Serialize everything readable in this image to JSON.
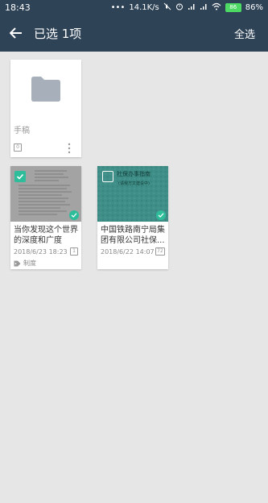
{
  "status_bar": {
    "time": "18:43",
    "dots": "•••",
    "network_speed": "14.1K/s",
    "battery_percent": "86%",
    "battery_badge": "86"
  },
  "app_bar": {
    "title": "已选 1项",
    "select_all_label": "全选"
  },
  "cards": [
    {
      "type": "folder",
      "title": "手稿",
      "badge": "0",
      "selected": false
    },
    {
      "type": "note",
      "title": "当你发现这个世界的深度和广度",
      "date": "2018/6/23 18:23",
      "badge": "1",
      "tag": "制度",
      "selected": true
    },
    {
      "type": "note",
      "title": "中国铁路南宁局集团有限公司社保...",
      "date": "2018/6/22 14:07",
      "badge": "72",
      "thumb_text": "社保办事指南",
      "thumb_subtext": "(请我方文建设中)",
      "selected": false
    }
  ],
  "colors": {
    "app_bar": "#2f4357",
    "accent": "#2dbd9b",
    "background": "#e6e6e6"
  }
}
